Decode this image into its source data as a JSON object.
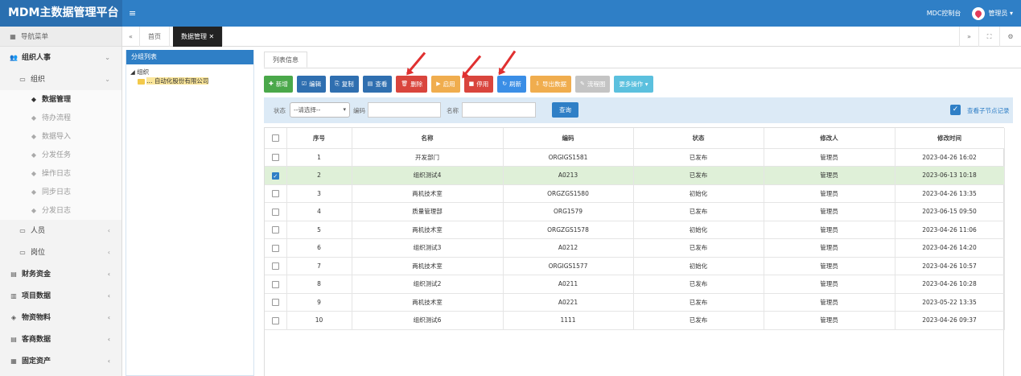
{
  "app": {
    "title": "MDM主数据管理平台",
    "menu_toggle": "≡"
  },
  "header": {
    "control_label": "MDC控制台",
    "user_label": "管理员 ▾"
  },
  "sidebar": {
    "nav_label": "导航菜单",
    "items": [
      {
        "label": "组织人事",
        "icon": "users-icon",
        "glyph": "👥",
        "level": 1,
        "arrow": "⌄",
        "expanded": true
      },
      {
        "label": "组织",
        "icon": "folder-icon",
        "glyph": "▭",
        "level": 2,
        "arrow": "⌄",
        "expanded": true
      },
      {
        "label": "数据管理",
        "icon": "tag-icon",
        "glyph": "◆",
        "level": 3,
        "active": true
      },
      {
        "label": "待办流程",
        "icon": "tag-icon",
        "glyph": "◆",
        "level": 3
      },
      {
        "label": "数据导入",
        "icon": "tag-icon",
        "glyph": "◆",
        "level": 3
      },
      {
        "label": "分发任务",
        "icon": "tag-icon",
        "glyph": "◆",
        "level": 3
      },
      {
        "label": "操作日志",
        "icon": "tag-icon",
        "glyph": "◆",
        "level": 3
      },
      {
        "label": "同步日志",
        "icon": "tag-icon",
        "glyph": "◆",
        "level": 3
      },
      {
        "label": "分发日志",
        "icon": "tag-icon",
        "glyph": "◆",
        "level": 3
      },
      {
        "label": "人员",
        "icon": "folder-icon",
        "glyph": "▭",
        "level": 2,
        "arrow": "‹"
      },
      {
        "label": "岗位",
        "icon": "folder-icon",
        "glyph": "▭",
        "level": 2,
        "arrow": "‹"
      },
      {
        "label": "财务资金",
        "icon": "card-icon",
        "glyph": "▤",
        "level": 1,
        "arrow": "‹"
      },
      {
        "label": "项目数据",
        "icon": "chart-icon",
        "glyph": "▥",
        "level": 1,
        "arrow": "‹"
      },
      {
        "label": "物资物料",
        "icon": "cubes-icon",
        "glyph": "◈",
        "level": 1,
        "arrow": "‹"
      },
      {
        "label": "客商数据",
        "icon": "list-icon",
        "glyph": "▤",
        "level": 1,
        "arrow": "‹"
      },
      {
        "label": "固定资产",
        "icon": "box-icon",
        "glyph": "▦",
        "level": 1,
        "arrow": "‹"
      }
    ]
  },
  "tabs": {
    "back": "«",
    "forward": "»",
    "fullscreen": "⛶",
    "settings": "⚙",
    "items": [
      {
        "label": "首页",
        "active": false
      },
      {
        "label": "数据管理 ✕",
        "active": true
      }
    ]
  },
  "tree": {
    "title": "分组列表",
    "nodes": [
      {
        "label": "◢ 组织",
        "level": 0
      },
      {
        "label": "… 自动化股份有限公司",
        "level": 1,
        "selected": true
      }
    ]
  },
  "list_tab": "列表信息",
  "toolbar": {
    "buttons": [
      {
        "label": "新增",
        "glyph": "✚",
        "color": "#4aa84a",
        "name": "add-button"
      },
      {
        "label": "编辑",
        "glyph": "☑",
        "color": "#2f6fb0",
        "name": "edit-button"
      },
      {
        "label": "复制",
        "glyph": "⎘",
        "color": "#2f6fb0",
        "name": "copy-button"
      },
      {
        "label": "查看",
        "glyph": "▤",
        "color": "#2f6fb0",
        "name": "view-button"
      },
      {
        "label": "删除",
        "glyph": "🗑",
        "color": "#d9453d",
        "name": "delete-button"
      },
      {
        "label": "启用",
        "glyph": "▶",
        "color": "#f0ad4e",
        "name": "enable-button"
      },
      {
        "label": "停用",
        "glyph": "■",
        "color": "#d9453d",
        "name": "disable-button"
      },
      {
        "label": "刷新",
        "glyph": "↻",
        "color": "#3a8ee6",
        "name": "refresh-button"
      },
      {
        "label": "导出数据",
        "glyph": "⇩",
        "color": "#f0ad4e",
        "name": "export-button"
      },
      {
        "label": "流程图",
        "glyph": "✎",
        "color": "#c4c4c4",
        "name": "flowchart-button"
      },
      {
        "label": "更多操作 ▾",
        "glyph": "",
        "color": "#5bc0de",
        "name": "more-actions-button"
      }
    ]
  },
  "search": {
    "status_label": "状态",
    "status_value": "--请选择--",
    "code_label": "编码",
    "code_value": "",
    "name_label": "名称",
    "name_value": "",
    "query_button": "查询",
    "include_children_checked": true,
    "include_children_label": "查看子节点记录"
  },
  "table": {
    "columns": [
      "",
      "序号",
      "名称",
      "编码",
      "状态",
      "修改人",
      "修改时间"
    ],
    "rows": [
      {
        "checked": false,
        "seq": "1",
        "name": "开发部门",
        "code": "ORGIGS1581",
        "status": "已发布",
        "modifier": "管理员",
        "time": "2023-04-26 16:02"
      },
      {
        "checked": true,
        "seq": "2",
        "name": "组织测试4",
        "code": "A0213",
        "status": "已发布",
        "modifier": "管理员",
        "time": "2023-06-13 10:18"
      },
      {
        "checked": false,
        "seq": "3",
        "name": "两机技术室",
        "code": "ORGZGS1580",
        "status": "初始化",
        "modifier": "管理员",
        "time": "2023-04-26 13:35"
      },
      {
        "checked": false,
        "seq": "4",
        "name": "质量管理部",
        "code": "ORG1579",
        "status": "已发布",
        "modifier": "管理员",
        "time": "2023-06-15 09:50"
      },
      {
        "checked": false,
        "seq": "5",
        "name": "两机技术室",
        "code": "ORGZGS1578",
        "status": "初始化",
        "modifier": "管理员",
        "time": "2023-04-26 11:06"
      },
      {
        "checked": false,
        "seq": "6",
        "name": "组织测试3",
        "code": "A0212",
        "status": "已发布",
        "modifier": "管理员",
        "time": "2023-04-26 14:20"
      },
      {
        "checked": false,
        "seq": "7",
        "name": "两机技术室",
        "code": "ORGIGS1577",
        "status": "初始化",
        "modifier": "管理员",
        "time": "2023-04-26 10:57"
      },
      {
        "checked": false,
        "seq": "8",
        "name": "组织测试2",
        "code": "A0211",
        "status": "已发布",
        "modifier": "管理员",
        "time": "2023-04-26 10:28"
      },
      {
        "checked": false,
        "seq": "9",
        "name": "两机技术室",
        "code": "A0221",
        "status": "已发布",
        "modifier": "管理员",
        "time": "2023-05-22 13:35"
      },
      {
        "checked": false,
        "seq": "10",
        "name": "组织测试6",
        "code": "1111",
        "status": "已发布",
        "modifier": "管理员",
        "time": "2023-04-26 09:37"
      }
    ]
  },
  "colors": {
    "primary": "#2f7fc6",
    "brand_bg": "#2a6fb0",
    "selected_row": "#dff0d8",
    "annotation_arrow": "#e03030"
  }
}
